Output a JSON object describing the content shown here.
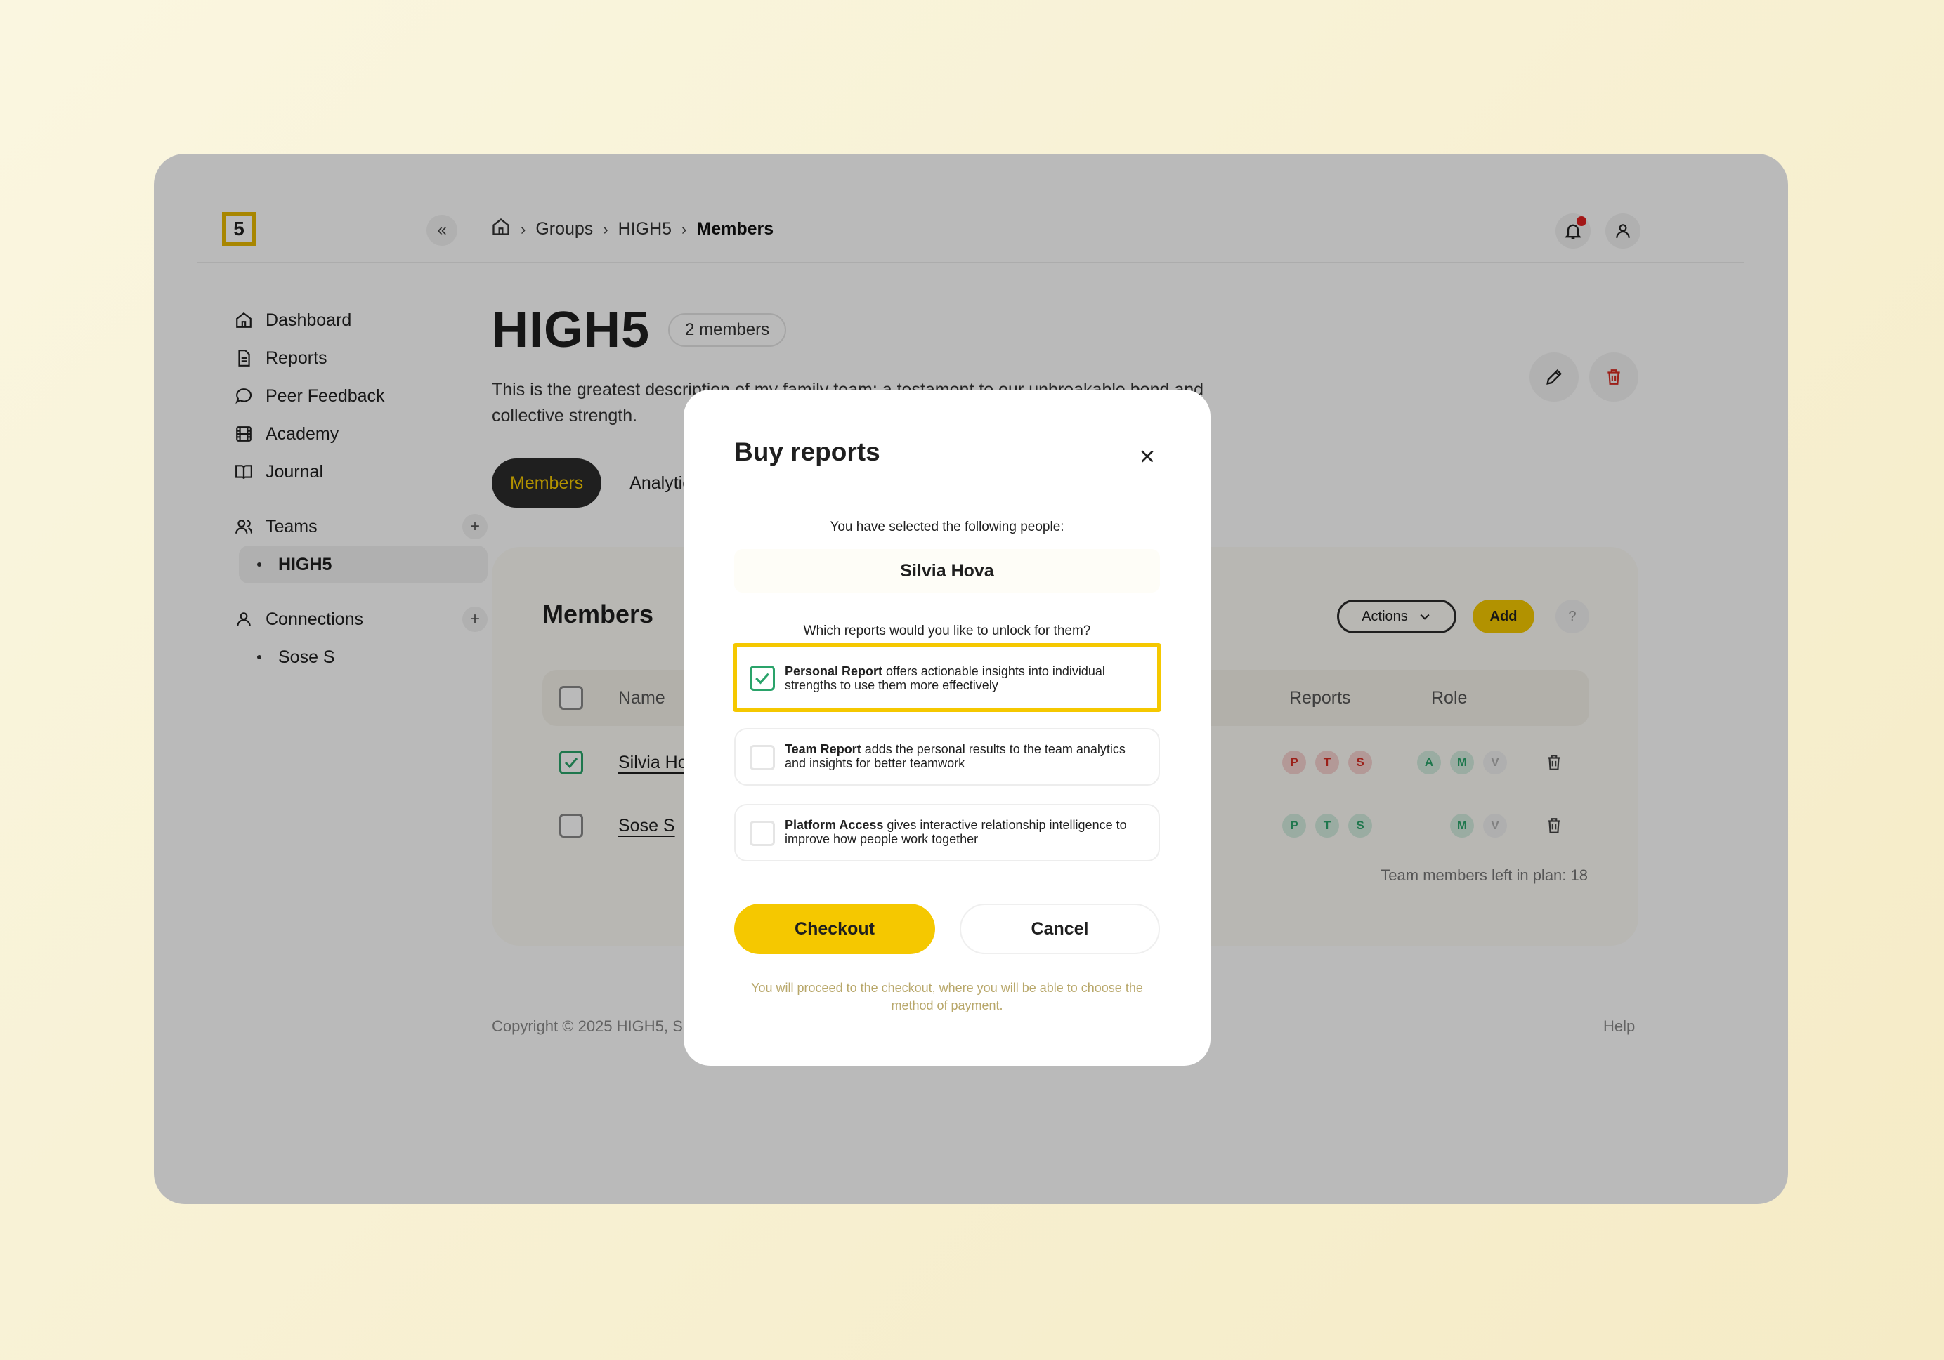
{
  "breadcrumb": {
    "items": [
      "Groups",
      "HIGH5"
    ],
    "current": "Members"
  },
  "logo": {
    "text": "5"
  },
  "collapse": {
    "icon": "double-chevron-left-icon",
    "glyph": "«"
  },
  "sidebar": {
    "items": [
      {
        "label": "Dashboard",
        "icon": "home-icon"
      },
      {
        "label": "Reports",
        "icon": "document-icon"
      },
      {
        "label": "Peer Feedback",
        "icon": "chat-bubble-icon"
      },
      {
        "label": "Academy",
        "icon": "film-icon"
      },
      {
        "label": "Journal",
        "icon": "book-icon"
      }
    ],
    "teams": {
      "label": "Teams",
      "children": [
        "HIGH5"
      ]
    },
    "connections": {
      "label": "Connections",
      "children": [
        "Sose S"
      ]
    }
  },
  "page": {
    "title": "HIGH5",
    "member_badge": "2 members",
    "description": "This is the greatest description of my family team: a testament to our unbreakable bond and collective strength."
  },
  "tabs": [
    {
      "label": "Members",
      "active": true
    },
    {
      "label": "Analytics",
      "active": false
    }
  ],
  "members_card": {
    "title": "Members",
    "actions_label": "Actions",
    "add_label": "Add",
    "help_label": "?",
    "columns": {
      "name": "Name",
      "reports": "Reports",
      "role": "Role"
    },
    "rows": [
      {
        "name": "Silvia Hova",
        "checked": true,
        "reports": [
          "P",
          "T",
          "S"
        ],
        "reports_state": "locked",
        "roles": [
          "A",
          "M",
          "V"
        ]
      },
      {
        "name": "Sose S",
        "checked": false,
        "reports": [
          "P",
          "T",
          "S"
        ],
        "reports_state": "unlocked",
        "roles": [
          "M",
          "V"
        ]
      }
    ],
    "plan_left": "Team members left in plan: 18"
  },
  "footer": {
    "copyright": "Copyright © 2025 HIGH5, S",
    "help": "Help"
  },
  "modal": {
    "title": "Buy reports",
    "selected_intro": "You have selected the following people:",
    "selected_person": "Silvia Hova",
    "question": "Which reports would you like to unlock for them?",
    "options": [
      {
        "name": "Personal Report",
        "text": " offers actionable insights into individual strengths to use them more effectively",
        "checked": true
      },
      {
        "name": "Team Report",
        "text": " adds the personal results to the team analytics and insights for better teamwork",
        "checked": false
      },
      {
        "name": "Platform Access",
        "text": " gives interactive relationship intelligence to improve how people work together",
        "checked": false
      }
    ],
    "checkout_label": "Checkout",
    "cancel_label": "Cancel",
    "note": "You will proceed to the checkout, where you will be able to choose the method of payment."
  },
  "colors": {
    "accent": "#f5c800",
    "success": "#2aa36a",
    "danger": "#d62b22"
  }
}
